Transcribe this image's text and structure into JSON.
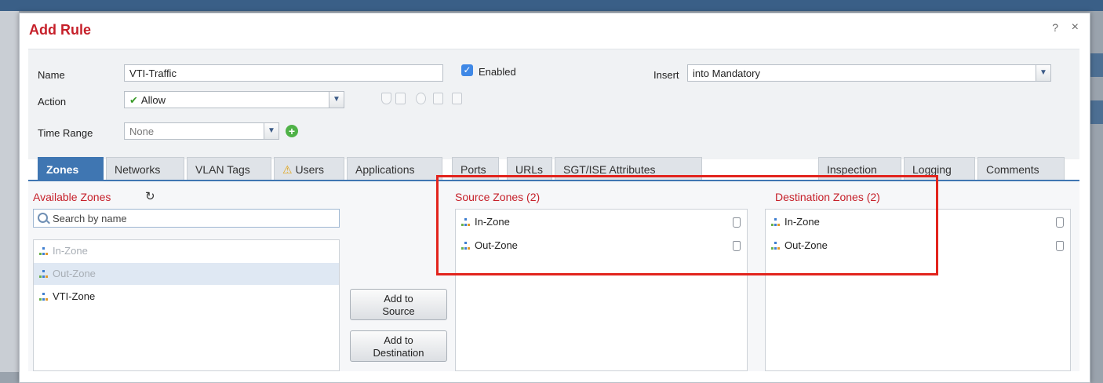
{
  "dialog": {
    "title": "Add Rule",
    "help": "?",
    "close": "×"
  },
  "form": {
    "name_label": "Name",
    "name_value": "VTI-Traffic",
    "enabled_label": "Enabled",
    "insert_label": "Insert",
    "insert_value": "into Mandatory",
    "action_label": "Action",
    "action_value": "Allow",
    "time_range_label": "Time Range",
    "time_range_value": "None"
  },
  "tabs": [
    "Zones",
    "Networks",
    "VLAN Tags",
    "Users",
    "Applications",
    "Ports",
    "URLs",
    "SGT/ISE Attributes",
    "Inspection",
    "Logging",
    "Comments"
  ],
  "available": {
    "title": "Available Zones",
    "search_placeholder": "Search by name",
    "items": [
      {
        "label": "In-Zone",
        "state": "used"
      },
      {
        "label": "Out-Zone",
        "state": "used"
      },
      {
        "label": "VTI-Zone",
        "state": "available"
      }
    ]
  },
  "buttons": {
    "add_source": [
      "Add to",
      "Source"
    ],
    "add_destination": [
      "Add to",
      "Destination"
    ]
  },
  "source": {
    "title": "Source Zones (2)",
    "items": [
      "In-Zone",
      "Out-Zone"
    ]
  },
  "destination": {
    "title": "Destination Zones (2)",
    "items": [
      "In-Zone",
      "Out-Zone"
    ]
  },
  "colors": {
    "title_red": "#c6202a",
    "tab_active": "#3f76b2",
    "highlight": "#e2241d"
  },
  "icons": {
    "zone": "network-zone-icon",
    "delete": "trash-icon",
    "refresh": "refresh-icon",
    "search": "search-icon",
    "add": "plus-circle-icon",
    "enabled": "checkbox-checked-icon",
    "allow": "checkmark-icon"
  }
}
